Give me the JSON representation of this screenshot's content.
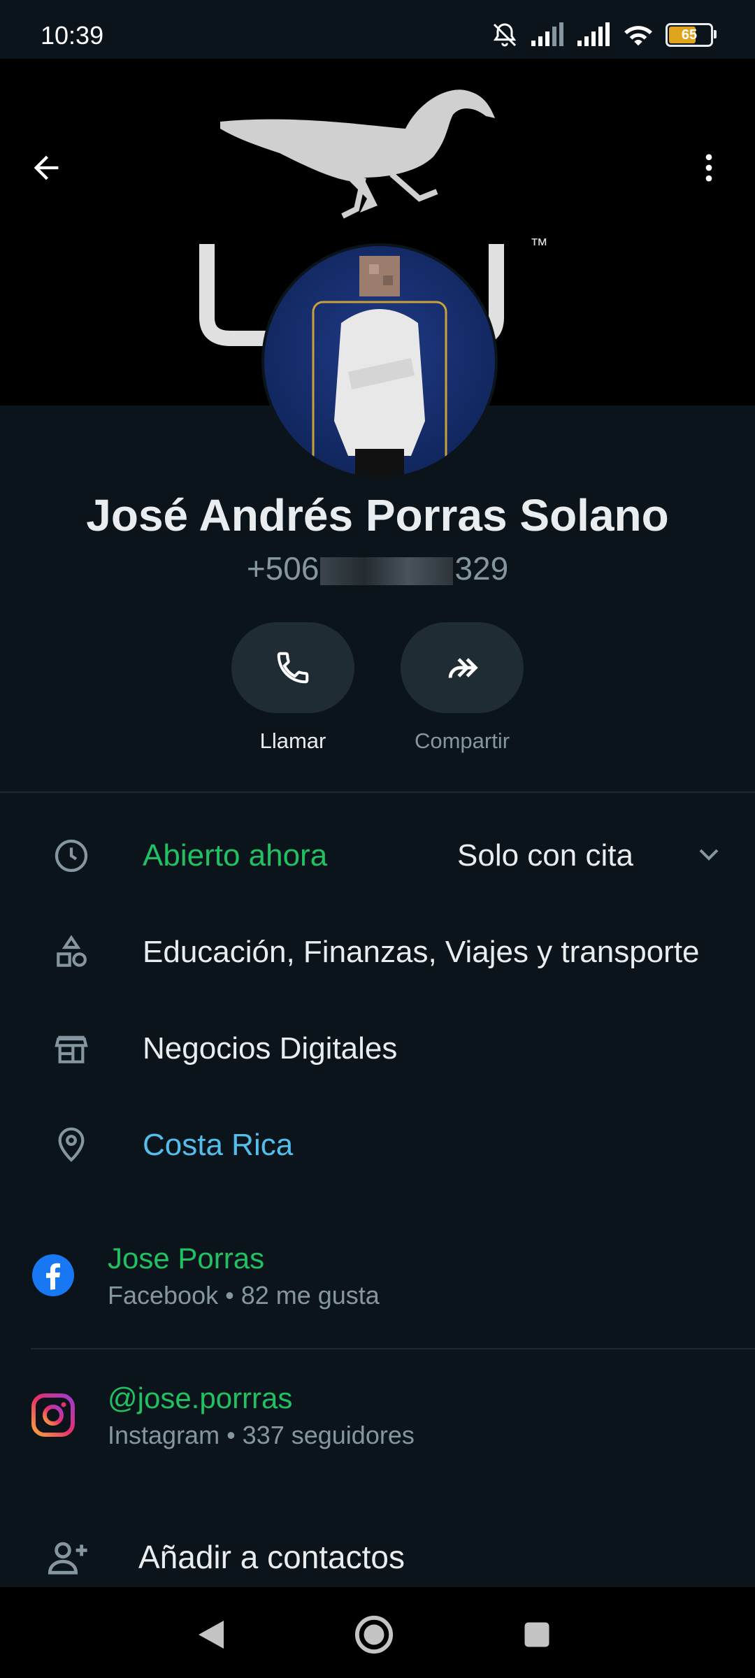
{
  "status_bar": {
    "time": "10:39",
    "battery": "65",
    "icons": [
      "bell-off-icon",
      "signal-icon",
      "signal-icon",
      "wifi-icon",
      "battery-icon"
    ]
  },
  "cover": {
    "brand_text": "JIFU",
    "trademark": "™"
  },
  "profile": {
    "name": "José Andrés Porras Solano",
    "phone_prefix": "+506",
    "phone_suffix": "329"
  },
  "actions": {
    "call": "Llamar",
    "share": "Compartir"
  },
  "business": {
    "hours_status": "Abierto ahora",
    "hours_detail": "Solo con cita",
    "categories": "Educación, Finanzas, Viajes y transporte",
    "description": "Negocios Digitales",
    "location": "Costa Rica"
  },
  "social": {
    "facebook": {
      "handle": "Jose Porras",
      "sub": "Facebook • 82 me gusta"
    },
    "instagram": {
      "handle": "@jose.porrras",
      "sub": "Instagram • 337 seguidores"
    }
  },
  "add_contact": "Añadir a contactos",
  "colors": {
    "background": "#0b141a",
    "accent_green": "#21c063",
    "link_blue": "#53bdeb",
    "button_bg": "#202c33"
  }
}
